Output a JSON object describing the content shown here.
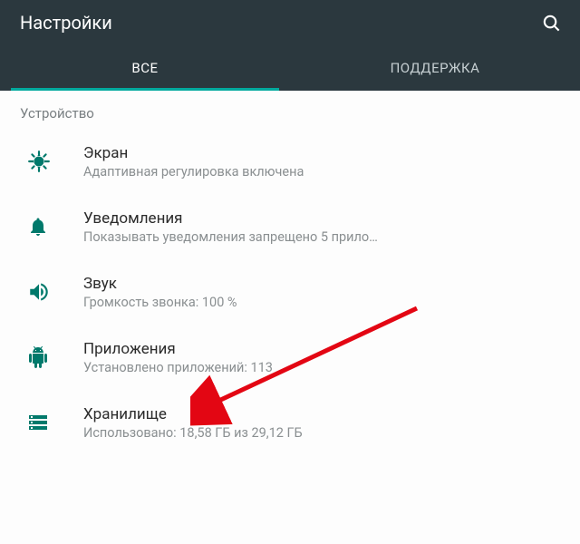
{
  "header": {
    "title": "Настройки"
  },
  "tabs": {
    "all": "ВСЕ",
    "support": "ПОДДЕРЖКА"
  },
  "section": {
    "device": "Устройство"
  },
  "items": {
    "display": {
      "title": "Экран",
      "sub": "Адаптивная регулировка включена"
    },
    "notifications": {
      "title": "Уведомления",
      "sub": "Показывать уведомления запрещено 5 прило…"
    },
    "sound": {
      "title": "Звук",
      "sub": "Громкость звонка: 100 %"
    },
    "apps": {
      "title": "Приложения",
      "sub": "Установлено приложений: 113"
    },
    "storage": {
      "title": "Хранилище",
      "sub": "Использовано: 18,58 ГБ из 29,12 ГБ"
    }
  },
  "colors": {
    "teal": "#00796b",
    "accent": "#00a99d",
    "bar": "#2b383e"
  }
}
